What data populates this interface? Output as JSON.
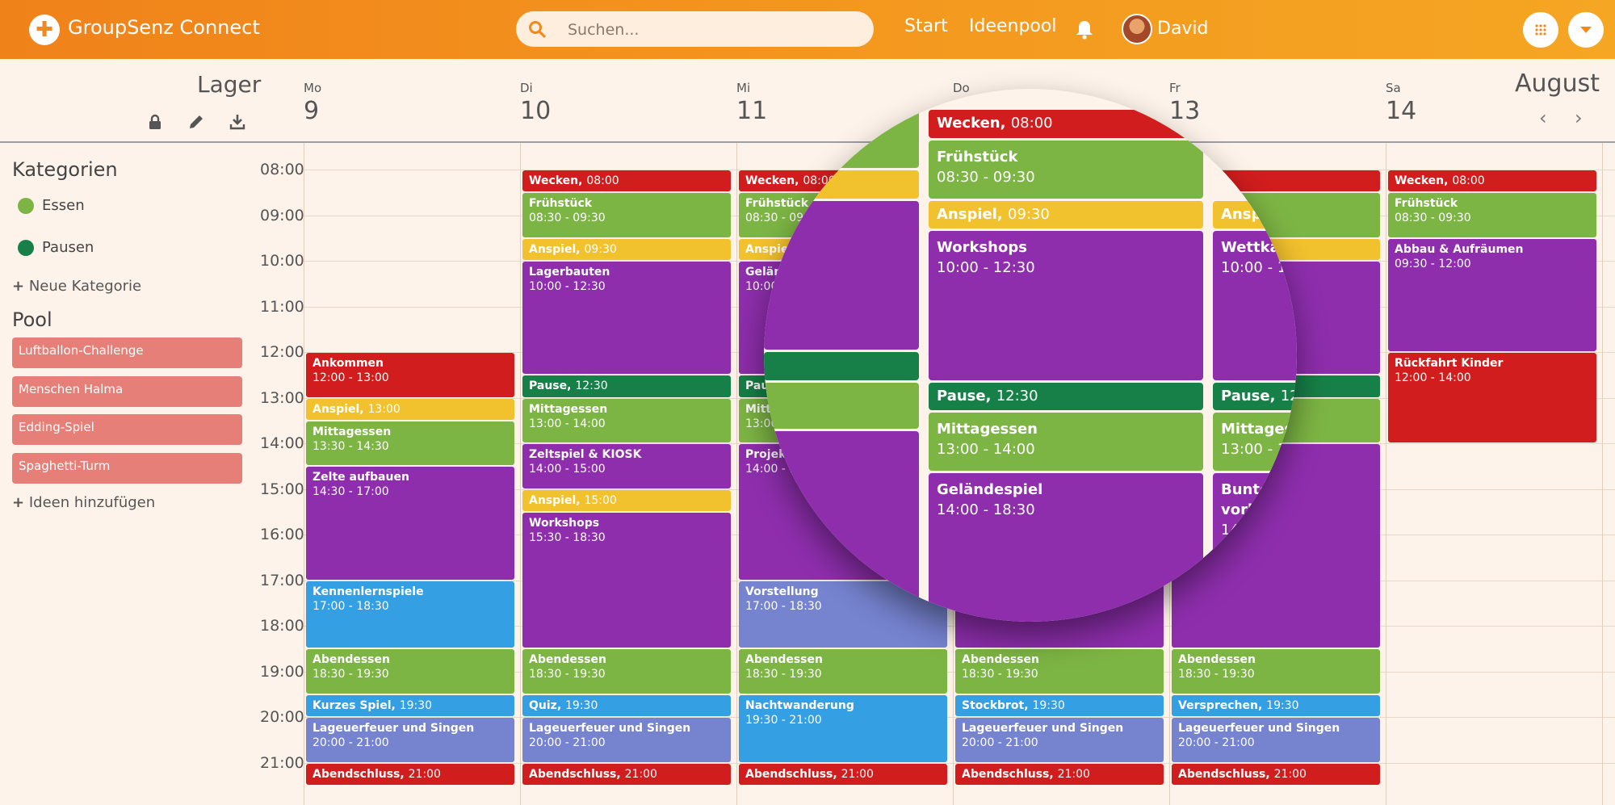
{
  "header": {
    "brand": "GroupSenz Connect",
    "search_placeholder": "Suchen...",
    "nav": [
      "Start",
      "Ideenpool"
    ],
    "user": "David"
  },
  "sidebar": {
    "title": "Lager",
    "categories_heading": "Kategorien",
    "categories": [
      {
        "label": "Essen",
        "color": "#7db544"
      },
      {
        "label": "Pausen",
        "color": "#178048"
      }
    ],
    "new_category": "Neue Kategorie",
    "pool_heading": "Pool",
    "pool_items": [
      "Luftballon-Challenge",
      "Menschen Halma",
      "Edding-Spiel",
      "Spaghetti-Turm"
    ],
    "add_ideas": "Ideen hinzufügen"
  },
  "calendar": {
    "month": "August",
    "days": [
      {
        "name": "Mo",
        "num": "9"
      },
      {
        "name": "Di",
        "num": "10"
      },
      {
        "name": "Mi",
        "num": "11"
      },
      {
        "name": "Do",
        "num": "12"
      },
      {
        "name": "Fr",
        "num": "13"
      },
      {
        "name": "Sa",
        "num": "14"
      }
    ],
    "hours": [
      "08:00",
      "09:00",
      "10:00",
      "11:00",
      "12:00",
      "13:00",
      "14:00",
      "15:00",
      "16:00",
      "17:00",
      "18:00",
      "19:00",
      "20:00",
      "21:00"
    ],
    "colors": {
      "red": "#d11d1d",
      "green": "#7db544",
      "yellow": "#f2c12e",
      "purple": "#8e2ead",
      "darkgreen": "#178048",
      "blue": "#349fe3",
      "indigo": "#7683cf"
    },
    "events": [
      {
        "day": 0,
        "start": 12.0,
        "end": 13.0,
        "title": "Ankommen",
        "time": "12:00 - 13:00",
        "color": "red",
        "style": "block"
      },
      {
        "day": 0,
        "start": 13.0,
        "end": 13.5,
        "title": "Anspiel",
        "time": "13:00",
        "color": "yellow",
        "style": "inline"
      },
      {
        "day": 0,
        "start": 13.5,
        "end": 14.5,
        "title": "Mittagessen",
        "time": "13:30 - 14:30",
        "color": "green",
        "style": "block"
      },
      {
        "day": 0,
        "start": 14.5,
        "end": 17.0,
        "title": "Zelte aufbauen",
        "time": "14:30 - 17:00",
        "color": "purple",
        "style": "block"
      },
      {
        "day": 0,
        "start": 17.0,
        "end": 18.5,
        "title": "Kennenlernspiele",
        "time": "17:00 - 18:30",
        "color": "blue",
        "style": "block"
      },
      {
        "day": 0,
        "start": 18.5,
        "end": 19.5,
        "title": "Abendessen",
        "time": "18:30 - 19:30",
        "color": "green",
        "style": "block"
      },
      {
        "day": 0,
        "start": 19.5,
        "end": 20.0,
        "title": "Kurzes Spiel",
        "time": "19:30",
        "color": "blue",
        "style": "inline"
      },
      {
        "day": 0,
        "start": 20.0,
        "end": 21.0,
        "title": "Lageuerfeuer und Singen",
        "time": "20:00 - 21:00",
        "color": "indigo",
        "style": "block"
      },
      {
        "day": 0,
        "start": 21.0,
        "end": 21.5,
        "title": "Abendschluss",
        "time": "21:00",
        "color": "red",
        "style": "inline"
      },
      {
        "day": 1,
        "start": 8.0,
        "end": 8.5,
        "title": "Wecken",
        "time": "08:00",
        "color": "red",
        "style": "inline"
      },
      {
        "day": 1,
        "start": 8.5,
        "end": 9.5,
        "title": "Frühstück",
        "time": "08:30 - 09:30",
        "color": "green",
        "style": "block"
      },
      {
        "day": 1,
        "start": 9.5,
        "end": 10.0,
        "title": "Anspiel",
        "time": "09:30",
        "color": "yellow",
        "style": "inline"
      },
      {
        "day": 1,
        "start": 10.0,
        "end": 12.5,
        "title": "Lagerbauten",
        "time": "10:00 - 12:30",
        "color": "purple",
        "style": "block"
      },
      {
        "day": 1,
        "start": 12.5,
        "end": 13.0,
        "title": "Pause",
        "time": "12:30",
        "color": "darkgreen",
        "style": "inline"
      },
      {
        "day": 1,
        "start": 13.0,
        "end": 14.0,
        "title": "Mittagessen",
        "time": "13:00 - 14:00",
        "color": "green",
        "style": "block"
      },
      {
        "day": 1,
        "start": 14.0,
        "end": 15.0,
        "title": "Zeltspiel & KIOSK",
        "time": "14:00 - 15:00",
        "color": "purple",
        "style": "block"
      },
      {
        "day": 1,
        "start": 15.0,
        "end": 15.5,
        "title": "Anspiel",
        "time": "15:00",
        "color": "yellow",
        "style": "inline"
      },
      {
        "day": 1,
        "start": 15.5,
        "end": 18.5,
        "title": "Workshops",
        "time": "15:30 - 18:30",
        "color": "purple",
        "style": "block"
      },
      {
        "day": 1,
        "start": 18.5,
        "end": 19.5,
        "title": "Abendessen",
        "time": "18:30 - 19:30",
        "color": "green",
        "style": "block"
      },
      {
        "day": 1,
        "start": 19.5,
        "end": 20.0,
        "title": "Quiz",
        "time": "19:30",
        "color": "blue",
        "style": "inline"
      },
      {
        "day": 1,
        "start": 20.0,
        "end": 21.0,
        "title": "Lageuerfeuer und Singen",
        "time": "20:00 - 21:00",
        "color": "indigo",
        "style": "block"
      },
      {
        "day": 1,
        "start": 21.0,
        "end": 21.5,
        "title": "Abendschluss",
        "time": "21:00",
        "color": "red",
        "style": "inline"
      },
      {
        "day": 2,
        "start": 8.0,
        "end": 8.5,
        "title": "Wecken",
        "time": "08:00",
        "color": "red",
        "style": "inline"
      },
      {
        "day": 2,
        "start": 8.5,
        "end": 9.5,
        "title": "Frühstück",
        "time": "08:30 - 09:30",
        "color": "green",
        "style": "block"
      },
      {
        "day": 2,
        "start": 9.5,
        "end": 10.0,
        "title": "Anspiel",
        "time": "09:30",
        "color": "yellow",
        "style": "inline"
      },
      {
        "day": 2,
        "start": 10.0,
        "end": 12.5,
        "title": "Geländespiel",
        "time": "10:00 - 12:30",
        "color": "purple",
        "style": "block"
      },
      {
        "day": 2,
        "start": 12.5,
        "end": 13.0,
        "title": "Pause",
        "time": "12:30",
        "color": "darkgreen",
        "style": "inline"
      },
      {
        "day": 2,
        "start": 13.0,
        "end": 14.0,
        "title": "Mittagessen",
        "time": "13:00 - 14:00",
        "color": "green",
        "style": "block"
      },
      {
        "day": 2,
        "start": 14.0,
        "end": 17.0,
        "title": "Projekt",
        "time": "14:00 - 17:00",
        "color": "purple",
        "style": "block"
      },
      {
        "day": 2,
        "start": 17.0,
        "end": 18.5,
        "title": "Vorstellung",
        "time": "17:00 - 18:30",
        "color": "indigo",
        "style": "block"
      },
      {
        "day": 2,
        "start": 18.5,
        "end": 19.5,
        "title": "Abendessen",
        "time": "18:30 - 19:30",
        "color": "green",
        "style": "block"
      },
      {
        "day": 2,
        "start": 19.5,
        "end": 21.0,
        "title": "Nachtwanderung",
        "time": "19:30 - 21:00",
        "color": "blue",
        "style": "block"
      },
      {
        "day": 2,
        "start": 21.0,
        "end": 21.5,
        "title": "Abendschluss",
        "time": "21:00",
        "color": "red",
        "style": "inline"
      },
      {
        "day": 3,
        "start": 14.0,
        "end": 18.5,
        "title": "Geländespiel",
        "time": "14:00 - 18:30",
        "color": "purple",
        "style": "block"
      },
      {
        "day": 3,
        "start": 18.5,
        "end": 19.5,
        "title": "Abendessen",
        "time": "18:30 - 19:30",
        "color": "green",
        "style": "block"
      },
      {
        "day": 3,
        "start": 19.5,
        "end": 20.0,
        "title": "Stockbrot",
        "time": "19:30",
        "color": "blue",
        "style": "inline"
      },
      {
        "day": 3,
        "start": 20.0,
        "end": 21.0,
        "title": "Lageuerfeuer und Singen",
        "time": "20:00 - 21:00",
        "color": "indigo",
        "style": "block"
      },
      {
        "day": 3,
        "start": 21.0,
        "end": 21.5,
        "title": "Abendschluss",
        "time": "21:00",
        "color": "red",
        "style": "inline"
      },
      {
        "day": 4,
        "start": 8.0,
        "end": 8.5,
        "title": "",
        "time": "08:00",
        "color": "red",
        "style": "inline"
      },
      {
        "day": 4,
        "start": 8.5,
        "end": 9.5,
        "title": "",
        "time": "",
        "color": "green",
        "style": "block"
      },
      {
        "day": 4,
        "start": 9.5,
        "end": 10.0,
        "title": "",
        "time": "",
        "color": "yellow",
        "style": "inline"
      },
      {
        "day": 4,
        "start": 10.0,
        "end": 12.5,
        "title": "",
        "time": "",
        "color": "purple",
        "style": "block"
      },
      {
        "day": 4,
        "start": 12.5,
        "end": 13.0,
        "title": "",
        "time": "",
        "color": "darkgreen",
        "style": "inline"
      },
      {
        "day": 4,
        "start": 13.0,
        "end": 14.0,
        "title": "",
        "time": "",
        "color": "green",
        "style": "block"
      },
      {
        "day": 4,
        "start": 14.0,
        "end": 18.5,
        "title": "",
        "time": "",
        "color": "purple",
        "style": "block"
      },
      {
        "day": 4,
        "start": 18.5,
        "end": 19.5,
        "title": "Abendessen",
        "time": "18:30 - 19:30",
        "color": "green",
        "style": "block"
      },
      {
        "day": 4,
        "start": 19.5,
        "end": 20.0,
        "title": "Versprechen",
        "time": "19:30",
        "color": "blue",
        "style": "inline"
      },
      {
        "day": 4,
        "start": 20.0,
        "end": 21.0,
        "title": "Lageuerfeuer und Singen",
        "time": "20:00 - 21:00",
        "color": "indigo",
        "style": "block"
      },
      {
        "day": 4,
        "start": 21.0,
        "end": 21.5,
        "title": "Abendschluss",
        "time": "21:00",
        "color": "red",
        "style": "inline"
      },
      {
        "day": 5,
        "start": 8.0,
        "end": 8.5,
        "title": "Wecken",
        "time": "08:00",
        "color": "red",
        "style": "inline"
      },
      {
        "day": 5,
        "start": 8.5,
        "end": 9.5,
        "title": "Frühstück",
        "time": "08:30 - 09:30",
        "color": "green",
        "style": "block"
      },
      {
        "day": 5,
        "start": 9.5,
        "end": 12.0,
        "title": "Abbau & Aufräumen",
        "time": "09:30 - 12:00",
        "color": "purple",
        "style": "block"
      },
      {
        "day": 5,
        "start": 12.0,
        "end": 14.0,
        "title": "Rückfahrt Kinder",
        "time": "12:00 - 14:00",
        "color": "red",
        "style": "block"
      }
    ],
    "magnified": [
      {
        "title": "Wecken",
        "time": "08:00",
        "color": "red",
        "style": "inline"
      },
      {
        "title": "Frühstück",
        "time": "08:30 - 09:30",
        "color": "green",
        "style": "block"
      },
      {
        "title": "Anspiel",
        "time": "09:30",
        "color": "yellow",
        "style": "inline"
      },
      {
        "title": "Workshops",
        "time": "10:00 - 12:30",
        "color": "purple",
        "style": "block"
      },
      {
        "title": "Pause",
        "time": "12:30",
        "color": "darkgreen",
        "style": "inline"
      },
      {
        "title": "Mittagessen",
        "time": "13:00 - 14:00",
        "color": "green",
        "style": "block"
      },
      {
        "title": "Geländespiel",
        "time": "14:00 - 18:30",
        "color": "purple",
        "style": "block"
      }
    ],
    "magnified_right": [
      {
        "title": "Anspiel",
        "color": "yellow",
        "style": "inline"
      },
      {
        "title": "Wettkampf",
        "time": "10:00 - 12:30",
        "color": "purple",
        "style": "block"
      },
      {
        "title": "Pause",
        "time": "12:30",
        "color": "darkgreen",
        "style": "inline"
      },
      {
        "title": "Mittagessen",
        "time": "13:00 - 14:00",
        "color": "green",
        "style": "block"
      },
      {
        "title": "Bunter Abend vorbereiten",
        "time": "14:00 - 18:30",
        "color": "purple",
        "style": "block"
      }
    ]
  }
}
